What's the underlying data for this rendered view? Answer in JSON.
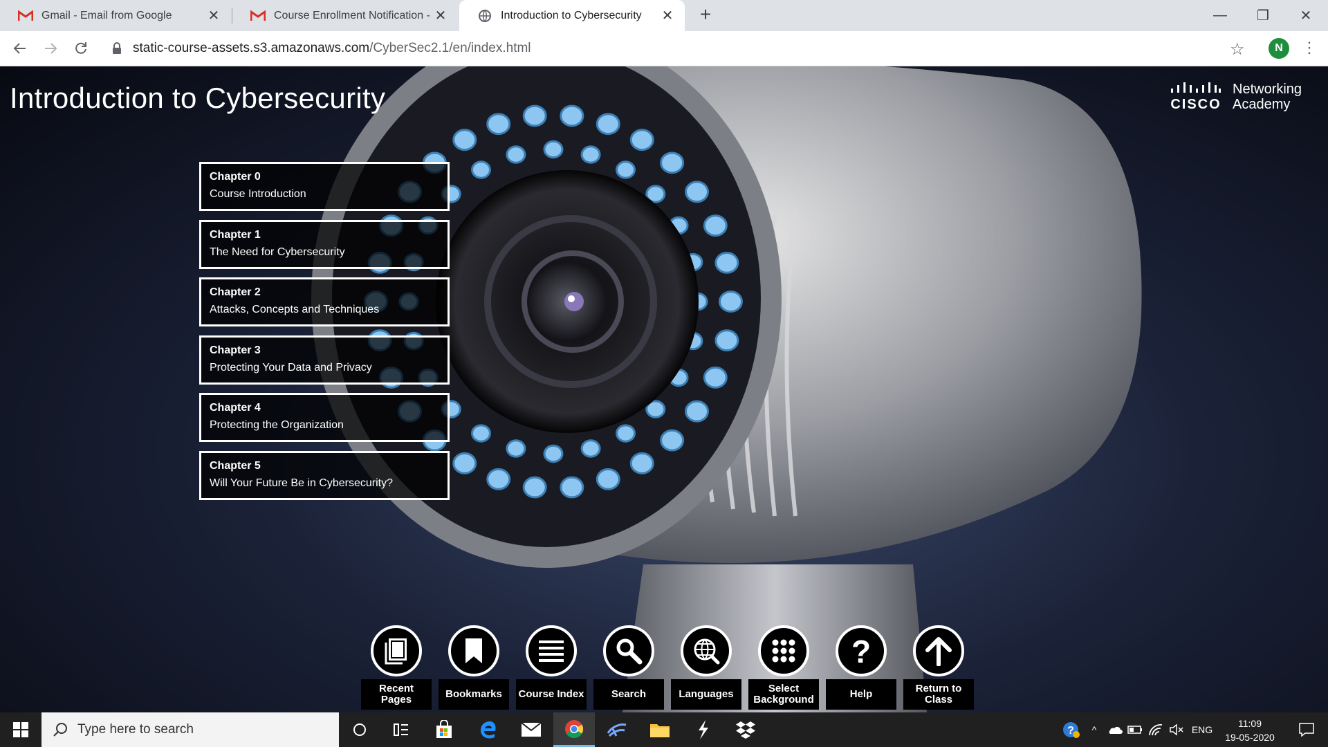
{
  "browser": {
    "tabs": [
      {
        "title": "Gmail - Email from Google",
        "icon": "gmail-icon",
        "active": false
      },
      {
        "title": "Course Enrollment Notification -",
        "icon": "gmail-icon",
        "active": false
      },
      {
        "title": "Introduction to Cybersecurity",
        "icon": "globe-icon",
        "active": true
      }
    ],
    "url_host": "static-course-assets.s3.amazonaws.com",
    "url_path": "/CyberSec2.1/en/index.html",
    "profile_initial": "N",
    "colors": {
      "gmail_red": "#d93025",
      "profile_green": "#1e8e3e"
    }
  },
  "course": {
    "title": "Introduction to Cybersecurity",
    "brand_word": "CISCO",
    "brand_line1": "Networking",
    "brand_line2": "Academy",
    "chapters": [
      {
        "number": "Chapter 0",
        "name": "Course Introduction"
      },
      {
        "number": "Chapter 1",
        "name": "The Need for Cybersecurity"
      },
      {
        "number": "Chapter 2",
        "name": "Attacks, Concepts and Techniques"
      },
      {
        "number": "Chapter 3",
        "name": "Protecting Your Data and Privacy"
      },
      {
        "number": "Chapter 4",
        "name": "Protecting the Organization"
      },
      {
        "number": "Chapter 5",
        "name": "Will Your Future Be in Cybersecurity?"
      }
    ],
    "menu": [
      {
        "label": "Recent Pages",
        "icon": "pages-icon"
      },
      {
        "label": "Bookmarks",
        "icon": "bookmark-icon"
      },
      {
        "label": "Course Index",
        "icon": "list-icon"
      },
      {
        "label": "Search",
        "icon": "search-icon"
      },
      {
        "label": "Languages",
        "icon": "globe-icon"
      },
      {
        "label": "Select Background",
        "icon": "grid-dots-icon"
      },
      {
        "label": "Help",
        "icon": "help-icon"
      },
      {
        "label": "Return to Class",
        "icon": "arrow-up-icon"
      }
    ]
  },
  "taskbar": {
    "search_placeholder": "Type here to search",
    "language": "ENG",
    "time": "11:09",
    "date": "19-05-2020"
  }
}
